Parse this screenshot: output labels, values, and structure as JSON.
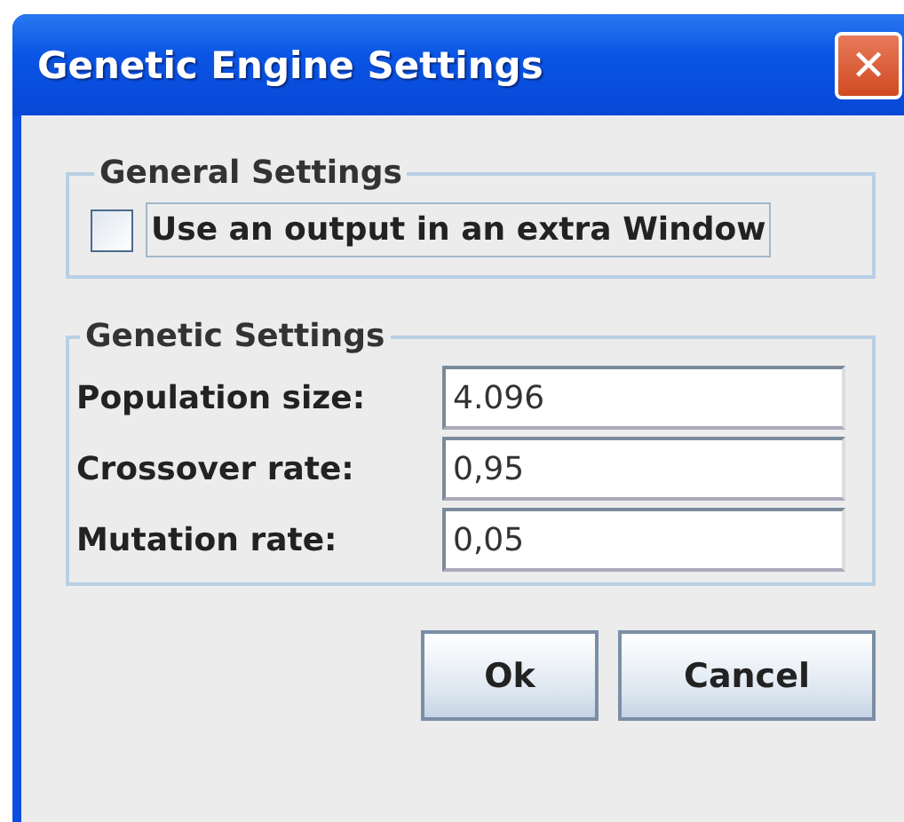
{
  "window": {
    "title": "Genetic Engine Settings",
    "close": "✕"
  },
  "general_settings": {
    "legend": "General Settings",
    "checkbox": {
      "label": "Use an output in an extra Window",
      "checked": false,
      "focused": true
    }
  },
  "genetic_settings": {
    "legend": "Genetic Settings",
    "fields": [
      {
        "label": "Population size:",
        "value": "4.096"
      },
      {
        "label": "Crossover rate:",
        "value": "0,95"
      },
      {
        "label": "Mutation rate:",
        "value": "0,05"
      }
    ]
  },
  "buttons": [
    "Ok",
    "Cancel"
  ]
}
